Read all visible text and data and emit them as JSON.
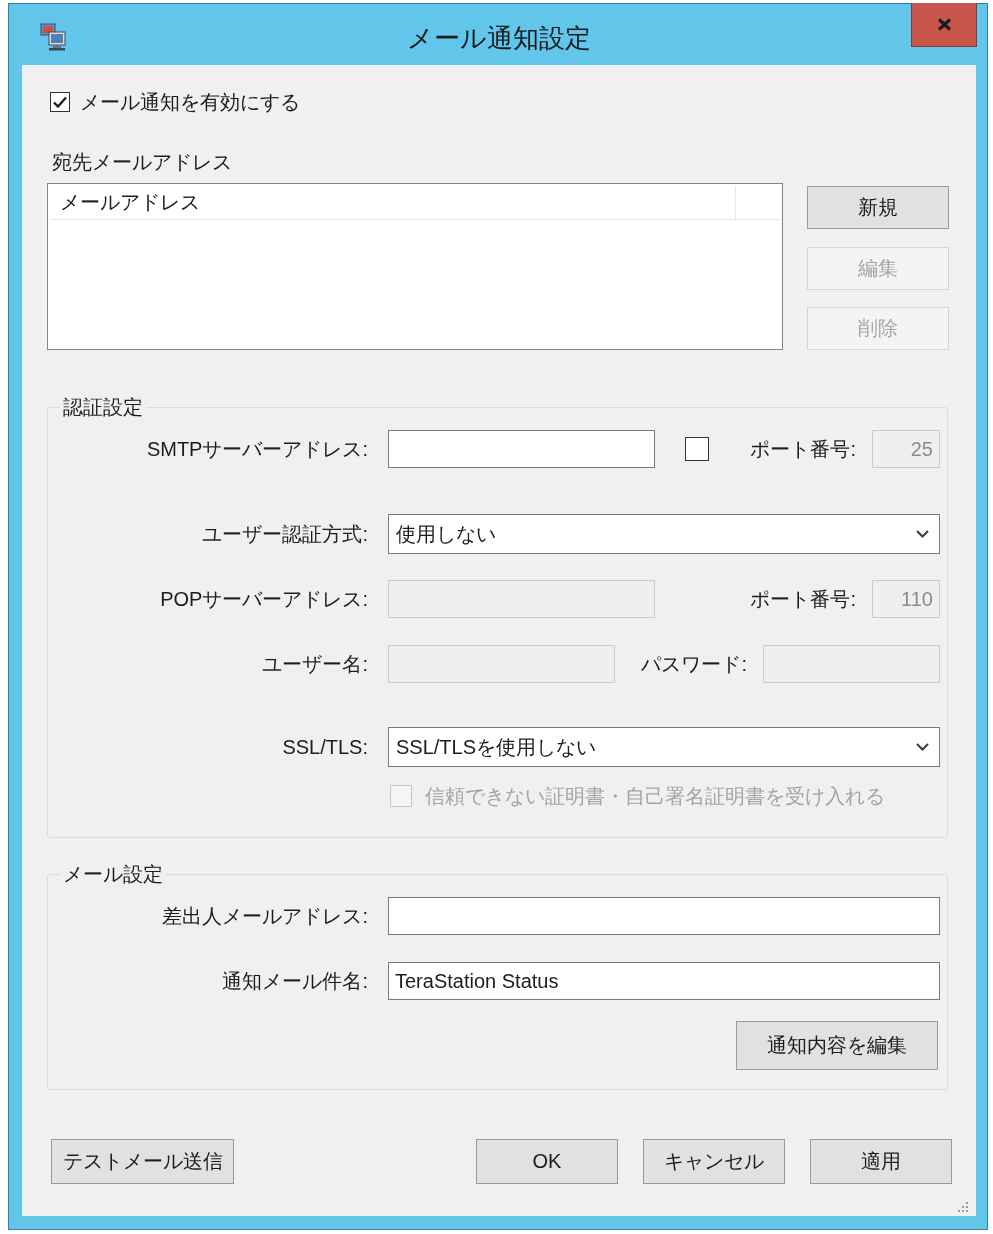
{
  "window": {
    "title": "メール通知設定"
  },
  "enable_notifications": {
    "label": "メール通知を有効にする",
    "checked": true
  },
  "recipients": {
    "label": "宛先メールアドレス",
    "columns": [
      "メールアドレス"
    ],
    "buttons": [
      {
        "label": "新規",
        "disabled": false
      },
      {
        "label": "編集",
        "disabled": true
      },
      {
        "label": "削除",
        "disabled": true
      }
    ]
  },
  "authentication": {
    "title": "認証設定",
    "smtp_server": {
      "label": "SMTPサーバーアドレス:",
      "disabled": false
    },
    "smtp_option": {
      "checked": false
    },
    "smtp_port": {
      "label": "ポート番号:",
      "value": "25",
      "disabled": true
    },
    "auth_method": {
      "label": "ユーザー認証方式:",
      "value": "使用しない"
    },
    "pop_server": {
      "label": "POPサーバーアドレス:",
      "disabled": true
    },
    "pop_port": {
      "label": "ポート番号:",
      "value": "110",
      "disabled": true
    },
    "username": {
      "label": "ユーザー名:",
      "disabled": true
    },
    "password": {
      "label": "パスワード:",
      "disabled": true
    },
    "ssl_tls": {
      "label": "SSL/TLS:",
      "value": "SSL/TLSを使用しない"
    },
    "accept_untrusted": {
      "label": "信頼できない証明書・自己署名証明書を受け入れる",
      "checked": false,
      "disabled": true
    }
  },
  "mail_settings": {
    "title": "メール設定",
    "sender": {
      "label": "差出人メールアドレス:",
      "disabled": false
    },
    "subject": {
      "label": "通知メール件名:",
      "value": "TeraStation Status",
      "disabled": false
    },
    "edit_button": {
      "label": "通知内容を編集"
    }
  },
  "footer": {
    "test_button": {
      "label": "テストメール送信"
    },
    "buttons": [
      {
        "label": "OK"
      },
      {
        "label": "キャンセル"
      },
      {
        "label": "適用"
      }
    ]
  }
}
